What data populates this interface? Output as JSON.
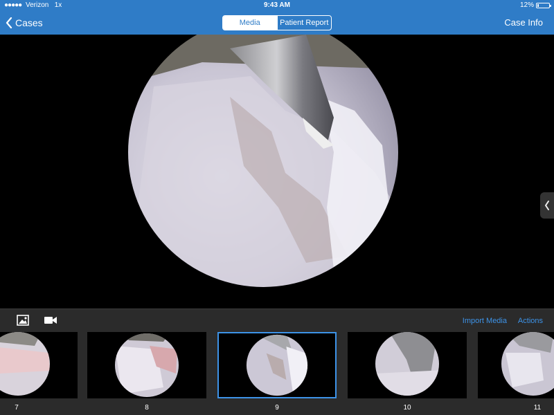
{
  "status_bar": {
    "signal_dots": "●●●●●",
    "carrier": "Verizon",
    "network": "1x",
    "time": "9:43 AM",
    "battery_percent": "12%",
    "battery_level": 0.12
  },
  "nav": {
    "back_label": "Cases",
    "right_label": "Case Info",
    "segments": [
      {
        "label": "Media",
        "active": true
      },
      {
        "label": "Patient Report",
        "active": false
      }
    ]
  },
  "toolbar": {
    "photo_icon": "image-icon",
    "video_icon": "video-camera-icon",
    "import_label": "Import Media",
    "actions_label": "Actions"
  },
  "thumbnails": [
    {
      "number": "7",
      "selected": false
    },
    {
      "number": "8",
      "selected": false
    },
    {
      "number": "9",
      "selected": true
    },
    {
      "number": "10",
      "selected": false
    },
    {
      "number": "11",
      "selected": false
    }
  ],
  "colors": {
    "header_blue": "#2f7cc7",
    "accent_blue": "#3d93e8",
    "toolbar_gray": "#2b2b2b"
  }
}
